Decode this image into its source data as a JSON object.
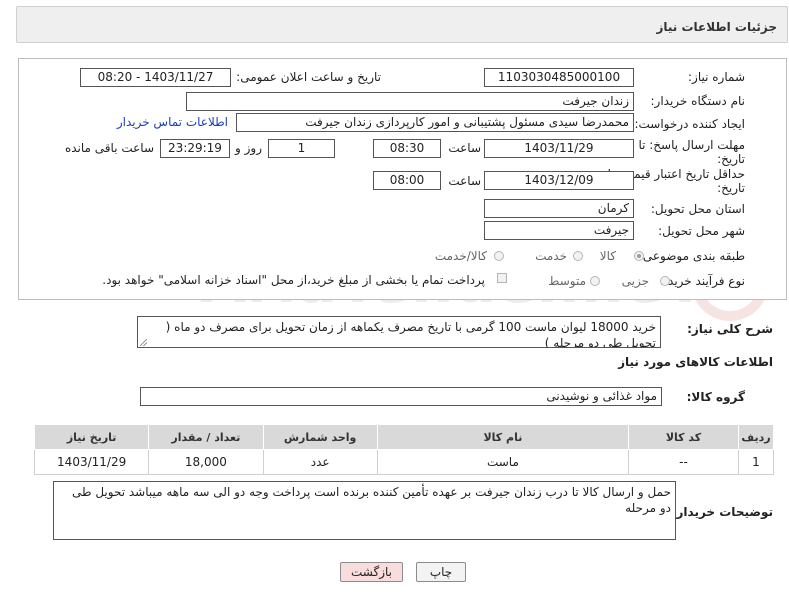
{
  "header": {
    "title": "جزئیات اطلاعات نیاز"
  },
  "form": {
    "need_number_label": "شماره نیاز:",
    "need_number": "1103030485000100",
    "announce_label": "تاریخ و ساعت اعلان عمومی:",
    "announce_value": "1403/11/27 - 08:20",
    "buyer_label": "نام دستگاه خریدار:",
    "buyer_value": "زندان جیرفت",
    "creator_label": "ایجاد کننده درخواست:",
    "creator_value": "محمدرضا سیدی مسئول پشتیبانی و امور کارپردازی زندان جیرفت",
    "contact_link": "اطلاعات تماس خریدار",
    "deadline_label_1": "مهلت ارسال پاسخ: تا",
    "deadline_label_2": "تاریخ:",
    "deadline_date": "1403/11/29",
    "time_word": "ساعت",
    "deadline_time": "08:30",
    "days_value": "1",
    "days_word": "روز و",
    "remaining_time": "23:29:19",
    "remaining_word": "ساعت باقی مانده",
    "validity_label_1": "حداقل تاریخ اعتبار قیمت: تا",
    "validity_label_2": "تاریخ:",
    "validity_date": "1403/12/09",
    "validity_time": "08:00",
    "province_label": "استان محل تحویل:",
    "province_value": "کرمان",
    "city_label": "شهر محل تحویل:",
    "city_value": "جیرفت",
    "category_label": "طبقه بندی موضوعی:",
    "category_options": [
      "کالا",
      "خدمت",
      "کالا/خدمت"
    ],
    "process_label": "نوع فرآیند خرید :",
    "process_options": [
      "جزیی",
      "متوسط"
    ],
    "payment_note": "پرداخت تمام یا بخشی از مبلغ خرید،از محل \"اسناد خزانه اسلامی\" خواهد بود."
  },
  "description": {
    "label": "شرح کلی نیاز:",
    "text": "خرید 18000 لیوان ماست 100 گرمی با تاریخ مصرف یکماهه از زمان تحویل برای  مصرف دو ماه ( تحویل طی دو مرحله )"
  },
  "goods": {
    "section_title": "اطلاعات کالاهای مورد نیاز",
    "group_label": "گروه کالا:",
    "group_value": "مواد غذائی و نوشیدنی",
    "columns": [
      "ردیف",
      "کد کالا",
      "نام کالا",
      "واحد شمارش",
      "تعداد / مقدار",
      "تاریخ نیاز"
    ],
    "rows": [
      {
        "row": "1",
        "code": "--",
        "name": "ماست",
        "unit": "عدد",
        "qty": "18,000",
        "date": "1403/11/29"
      }
    ]
  },
  "buyer_notes": {
    "label": "توضیحات خریدار:",
    "text": "حمل و ارسال کالا تا درب زندان جیرفت بر عهده تأمین کننده برنده است پرداخت وجه دو الی سه ماهه میباشد تحویل طی دو مرحله"
  },
  "buttons": {
    "print": "چاپ",
    "back": "بازگشت"
  },
  "watermark_text": "AriaTender.neT",
  "colors": {
    "link": "#1a3fb5",
    "back_button_bg": "#f9dcdc",
    "header_bg": "#efefef",
    "table_header_bg": "#d9d9d9"
  }
}
